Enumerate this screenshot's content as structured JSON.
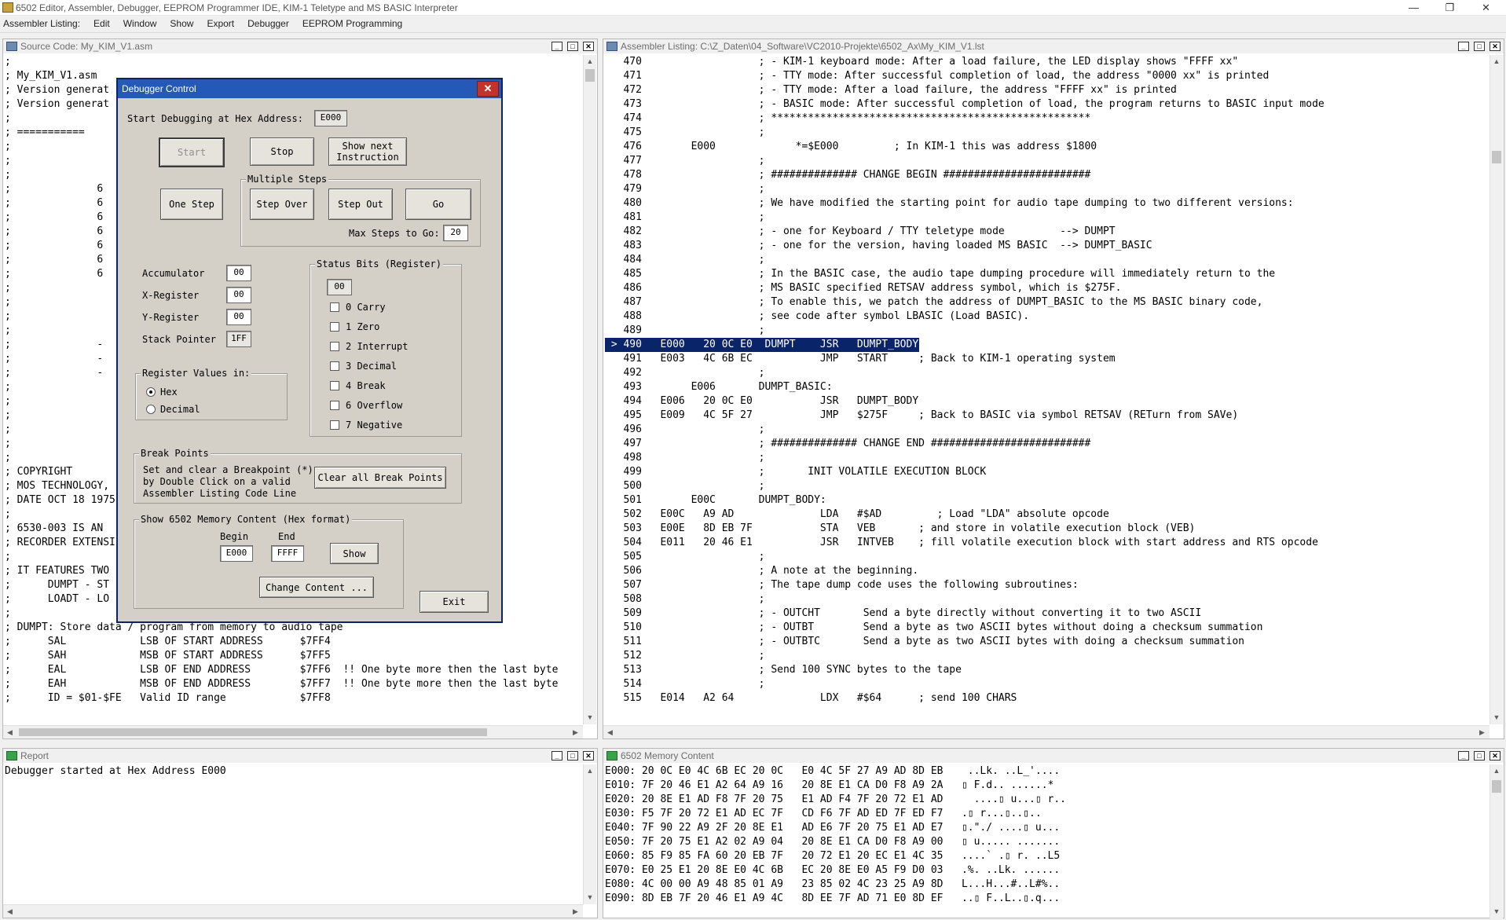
{
  "app": {
    "title": "6502 Editor, Assembler, Debugger, EEPROM Programmer IDE, KIM-1 Teletype and MS BASIC Interpreter",
    "window_buttons": [
      "—",
      "❐",
      "✕"
    ]
  },
  "menu": [
    "Assembler Listing:",
    "Edit",
    "Window",
    "Show",
    "Export",
    "Debugger",
    "EEPROM Programming"
  ],
  "source": {
    "title": "Source Code: My_KIM_V1.asm",
    "lines": [
      ";",
      "; My_KIM_V1.asm",
      "; Version generat",
      "; Version generat",
      ";",
      "; ===========                                                    ===",
      ";",
      ";",
      ";",
      ";              6",
      ";              6",
      ";              6",
      ";              6",
      ";              6",
      ";              6",
      ";              6",
      ";",
      ";",
      ";",
      ";",
      ";              -",
      ";              -",
      ";              -",
      ";",
      ";",
      ";",
      ";",
      ";",
      ";",
      "; COPYRIGHT",
      "; MOS TECHNOLOGY,",
      "; DATE OCT 18 1975",
      ";",
      "; 6530-003 IS AN",
      "; RECORDER EXTENSI",
      ";",
      "; IT FEATURES TWO",
      ";      DUMPT - ST",
      ";      LOADT - LO",
      ";",
      "; DUMPT: Store data / program from memory to audio tape",
      ";      SAL            LSB OF START ADDRESS      $7FF4",
      ";      SAH            MSB OF START ADDRESS      $7FF5",
      ";      EAL            LSB OF END ADDRESS        $7FF6  !! One byte more then the last byte",
      ";      EAH            MSB OF END ADDRESS        $7FF7  !! One byte more then the last byte",
      ";      ID = $01-$FE   Valid ID range            $7FF8"
    ]
  },
  "listing": {
    "title": "Assembler Listing: C:\\Z_Daten\\04_Software\\VC2010-Projekte\\6502_Ax\\My_KIM_V1.lst",
    "lines": [
      "   470                   ; - KIM-1 keyboard mode: After a load failure, the LED display shows \"FFFF xx\"",
      "   471                   ; - TTY mode: After successful completion of load, the address \"0000 xx\" is printed",
      "   472                   ; - TTY mode: After a load failure, the address \"FFFF xx\" is printed",
      "   473                   ; - BASIC mode: After successful completion of load, the program returns to BASIC input mode",
      "   474                   ; ****************************************************",
      "   475                   ;",
      "   476        E000             *=$E000         ; In KIM-1 this was address $1800",
      "   477                   ;",
      "   478                   ; ############## CHANGE BEGIN ########################",
      "   479                   ;",
      "   480                   ; We have modified the starting point for audio tape dumping to two different versions:",
      "   481                   ;",
      "   482                   ; - one for Keyboard / TTY teletype mode         --> DUMPT",
      "   483                   ; - one for the version, having loaded MS BASIC  --> DUMPT_BASIC",
      "   484                   ;",
      "   485                   ; In the BASIC case, the audio tape dumping procedure will immediately return to the",
      "   486                   ; MS BASIC specified RETSAV address symbol, which is $275F.",
      "   487                   ; To enable this, we patch the address of DUMPT_BASIC to the MS BASIC binary code,",
      "   488                   ; see code after symbol LBASIC (Load BASIC).",
      "   489                   ;",
      " > 490   E000   20 0C E0  DUMPT    JSR   DUMPT_BODY",
      "   491   E003   4C 6B EC           JMP   START     ; Back to KIM-1 operating system",
      "   492                   ;",
      "   493        E006       DUMPT_BASIC:",
      "   494   E006   20 0C E0           JSR   DUMPT_BODY",
      "   495   E009   4C 5F 27           JMP   $275F     ; Back to BASIC via symbol RETSAV (RETurn from SAVe)",
      "   496                   ;",
      "   497                   ; ############## CHANGE END ##########################",
      "   498                   ;",
      "   499                   ;       INIT VOLATILE EXECUTION BLOCK",
      "   500                   ;",
      "   501        E00C       DUMPT_BODY:",
      "   502   E00C   A9 AD              LDA   #$AD         ; Load \"LDA\" absolute opcode",
      "   503   E00E   8D EB 7F           STA   VEB       ; and store in volatile execution block (VEB)",
      "   504   E011   20 46 E1           JSR   INTVEB    ; fill volatile execution block with start address and RTS opcode",
      "   505                   ;",
      "   506                   ; A note at the beginning.",
      "   507                   ; The tape dump code uses the following subroutines:",
      "   508                   ;",
      "   509                   ; - OUTCHT       Send a byte directly without converting it to two ASCII",
      "   510                   ; - OUTBT        Send a byte as two ASCII bytes without doing a checksum summation",
      "   511                   ; - OUTBTC       Send a byte as two ASCII bytes with doing a checksum summation",
      "   512                   ;",
      "   513                   ; Send 100 SYNC bytes to the tape",
      "   514                   ;",
      "   515   E014   A2 64              LDX   #$64      ; send 100 CHARS"
    ],
    "highlight_index": 20
  },
  "report": {
    "title": "Report",
    "lines": [
      "Debugger started at Hex Address E000"
    ]
  },
  "memory": {
    "title": "6502 Memory Content",
    "lines": [
      "E000: 20 0C E0 4C 6B EC 20 0C   E0 4C 5F 27 A9 AD 8D EB    ..Lk. ..L_'....",
      "E010: 7F 20 46 E1 A2 64 A9 16   20 8E E1 CA D0 F8 A9 2A   ▯ F.d.. ......*",
      "E020: 20 8E E1 AD F8 7F 20 75   E1 AD F4 7F 20 72 E1 AD     ....▯ u...▯ r..",
      "E030: F5 7F 20 72 E1 AD EC 7F   CD F6 7F AD ED 7F ED F7   .▯ r...▯..▯..",
      "E040: 7F 90 22 A9 2F 20 8E E1   AD E6 7F 20 75 E1 AD E7   ▯.\"./ ....▯ u...",
      "E050: 7F 20 75 E1 A2 02 A9 04   20 8E E1 CA D0 F8 A9 00   ▯ u..... .......",
      "E060: 85 F9 85 FA 60 20 EB 7F   20 72 E1 20 EC E1 4C 35   ....` .▯ r. ..L5",
      "E070: E0 25 E1 20 8E E0 4C 6B   EC 20 8E E0 A5 F9 D0 03   .%. ..Lk. ......",
      "E080: 4C 00 00 A9 48 85 01 A9   23 85 02 4C 23 25 A9 8D   L...H...#..L#%..",
      "E090: 8D EB 7F 20 46 E1 A9 4C   8D EE 7F AD 71 E0 8D EF   ..▯ F..L..▯.q..."
    ]
  },
  "debugger": {
    "title": "Debugger Control",
    "close": "✕",
    "start_label": "Start Debugging at Hex Address:",
    "start_address": "E000",
    "btn_start": "Start",
    "btn_stop": "Stop",
    "btn_show_next_1": "Show next",
    "btn_show_next_2": "Instruction",
    "multiple_steps_label": "Multiple Steps",
    "btn_one_step": "One Step",
    "btn_step_over": "Step Over",
    "btn_step_out": "Step Out",
    "btn_go": "Go",
    "max_steps_label": "Max Steps to Go:",
    "max_steps": "20",
    "accumulator_label": "Accumulator",
    "accumulator": "00",
    "xreg_label": "X-Register",
    "xreg": "00",
    "yreg_label": "Y-Register",
    "yreg": "00",
    "sp_label": "Stack Pointer",
    "sp": "1FF",
    "status_label": "Status Bits (Register)",
    "status_value": "00",
    "status_bits": [
      "0 Carry",
      "1 Zero",
      "2 Interrupt",
      "3 Decimal",
      "4 Break",
      "6 Overflow",
      "7 Negative"
    ],
    "reg_values_label": "Register Values in:",
    "radio_hex": "Hex",
    "radio_decimal": "Decimal",
    "radio_selected": "Hex",
    "bp_label": "Break Points",
    "bp_text_1": "Set and clear a Breakpoint (*)",
    "bp_text_2": "by Double Click on a valid",
    "bp_text_3": "Assembler Listing Code Line",
    "btn_clear_bp": "Clear all Break Points",
    "mem_label": "Show 6502 Memory Content (Hex format)",
    "begin_label": "Begin",
    "end_label": "End",
    "mem_begin": "E000",
    "mem_end": "FFFF",
    "btn_show": "Show",
    "btn_change": "Change Content ...",
    "btn_exit": "Exit"
  },
  "colors": {
    "highlight_bg": "#0a246a",
    "dialog_caption": "#2459b7",
    "dialog_bg": "#d4d0c8"
  }
}
